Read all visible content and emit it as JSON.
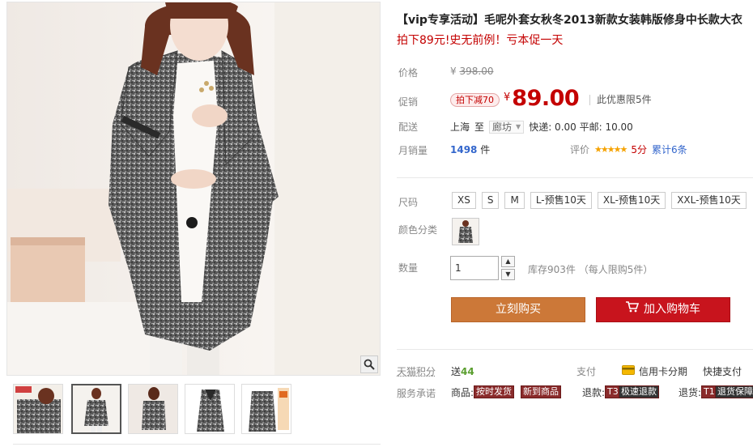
{
  "product": {
    "title": "【vip专享活动】毛呢外套女秋冬2013新款女装韩版修身中长款大衣",
    "promo": "拍下89元!史无前例！亏本促一天"
  },
  "price": {
    "label": "价格",
    "currency_symbol": "¥",
    "original": "398.00"
  },
  "promotion": {
    "label": "促销",
    "discount_tag": "拍下减70",
    "currency_symbol": "¥",
    "current": "89.00",
    "limit_note": "此优惠限5件"
  },
  "shipping": {
    "label": "配送",
    "from": "上海",
    "to_word": "至",
    "to_city": "廊坊",
    "fees": "快递: 0.00 平邮: 10.00"
  },
  "sales": {
    "label": "月销量",
    "count": "1498",
    "unit": "件"
  },
  "rating": {
    "label": "评价",
    "stars": "★★★★★",
    "star_value": 5,
    "score": "5分",
    "total": "累计6条"
  },
  "size": {
    "label": "尺码",
    "options": [
      "XS",
      "S",
      "M",
      "L-预售10天",
      "XL-预售10天",
      "XXL-预售10天"
    ]
  },
  "color": {
    "label": "颜色分类"
  },
  "quantity": {
    "label": "数量",
    "value": "1",
    "stock": "库存903件 （每人限购5件）"
  },
  "actions": {
    "buy_now": "立刻购买",
    "add_to_cart": "加入购物车"
  },
  "points": {
    "label": "天猫积分",
    "prefix": "送",
    "value": "44"
  },
  "payment": {
    "label": "支付",
    "credit": "信用卡分期",
    "quick": "快捷支付"
  },
  "service": {
    "label": "服务承诺",
    "goods_label": "商品:",
    "tag_ship": "按时发货",
    "tag_new": "新到商品",
    "refund_label": "退款:",
    "refund_code": "T3",
    "refund_tag": "极速退款",
    "return_label": "退货:",
    "return_code": "T1",
    "return_tag": "退货保障"
  },
  "colors": {
    "price_red": "#c40000",
    "buy_now_bg": "#cc7838",
    "add_cart_bg": "#c8141d",
    "star": "#f5a200",
    "link_blue": "#3366cc"
  },
  "icons": {
    "zoom": "magnifier-icon",
    "cart": "cart-icon",
    "credit_card": "credit-card-icon"
  }
}
